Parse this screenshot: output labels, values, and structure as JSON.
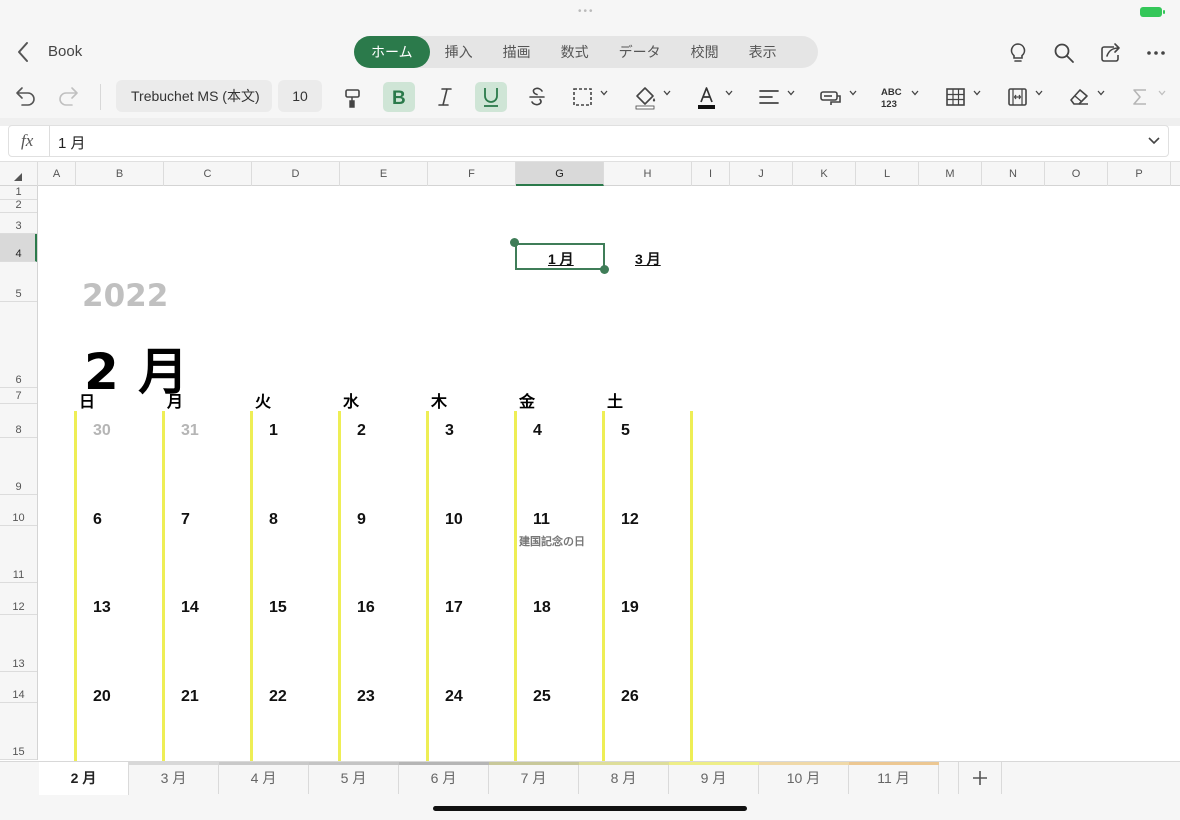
{
  "app": {
    "book_title": "Book",
    "ribbon_tabs": [
      {
        "label": "ホーム",
        "active": true
      },
      {
        "label": "挿入"
      },
      {
        "label": "描画"
      },
      {
        "label": "数式"
      },
      {
        "label": "データ"
      },
      {
        "label": "校閲"
      },
      {
        "label": "表示"
      }
    ]
  },
  "toolbar": {
    "font_name": "Trebuchet MS (本文)",
    "font_size": "10",
    "bold_active": true,
    "underline_active": true,
    "accent_color": "#2b7a4b",
    "toggle_bg": "#cfe5d6"
  },
  "formula_bar": {
    "fx_label": "fx",
    "value": "1 月"
  },
  "grid": {
    "columns": [
      "A",
      "B",
      "C",
      "D",
      "E",
      "F",
      "G",
      "H",
      "I",
      "J",
      "K",
      "L",
      "M",
      "N",
      "O",
      "P"
    ],
    "selected_column": "G",
    "rows": [
      "1",
      "2",
      "3",
      "4",
      "5",
      "6",
      "7",
      "8",
      "9",
      "10",
      "11",
      "12",
      "13",
      "14",
      "15"
    ],
    "selected_row": "4"
  },
  "calendar": {
    "prev_month_link": "1 月",
    "next_month_link": "3 月",
    "year": "2022",
    "month_title": "2 月",
    "weekdays": [
      "日",
      "月",
      "火",
      "水",
      "木",
      "金",
      "土"
    ],
    "weeks": [
      [
        {
          "d": "30",
          "muted": true
        },
        {
          "d": "31",
          "muted": true
        },
        {
          "d": "1"
        },
        {
          "d": "2"
        },
        {
          "d": "3"
        },
        {
          "d": "4"
        },
        {
          "d": "5"
        }
      ],
      [
        {
          "d": "6"
        },
        {
          "d": "7"
        },
        {
          "d": "8"
        },
        {
          "d": "9"
        },
        {
          "d": "10"
        },
        {
          "d": "11",
          "holiday": "建国記念の日"
        },
        {
          "d": "12"
        }
      ],
      [
        {
          "d": "13"
        },
        {
          "d": "14"
        },
        {
          "d": "15"
        },
        {
          "d": "16"
        },
        {
          "d": "17"
        },
        {
          "d": "18"
        },
        {
          "d": "19"
        }
      ],
      [
        {
          "d": "20"
        },
        {
          "d": "21"
        },
        {
          "d": "22"
        },
        {
          "d": "23"
        },
        {
          "d": "24"
        },
        {
          "d": "25"
        },
        {
          "d": "26"
        }
      ]
    ],
    "line_color": "#eeee55",
    "muted_color": "#b5b5b5",
    "year_color": "#c0c0c0"
  },
  "sheet_tabs": [
    {
      "label": "2 月",
      "active": true,
      "color": "#ffffff"
    },
    {
      "label": "3 月",
      "color": "#d8d8d8"
    },
    {
      "label": "4 月",
      "color": "#c9c9c9"
    },
    {
      "label": "5 月",
      "color": "#c4c4c4"
    },
    {
      "label": "6 月",
      "color": "#b5b5b5"
    },
    {
      "label": "7 月",
      "color": "#c8c89a"
    },
    {
      "label": "8 月",
      "color": "#dede9a"
    },
    {
      "label": "9 月",
      "color": "#eeee88"
    },
    {
      "label": "10 月",
      "color": "#f0d9a8"
    },
    {
      "label": "11 月",
      "color": "#ecc792"
    }
  ]
}
